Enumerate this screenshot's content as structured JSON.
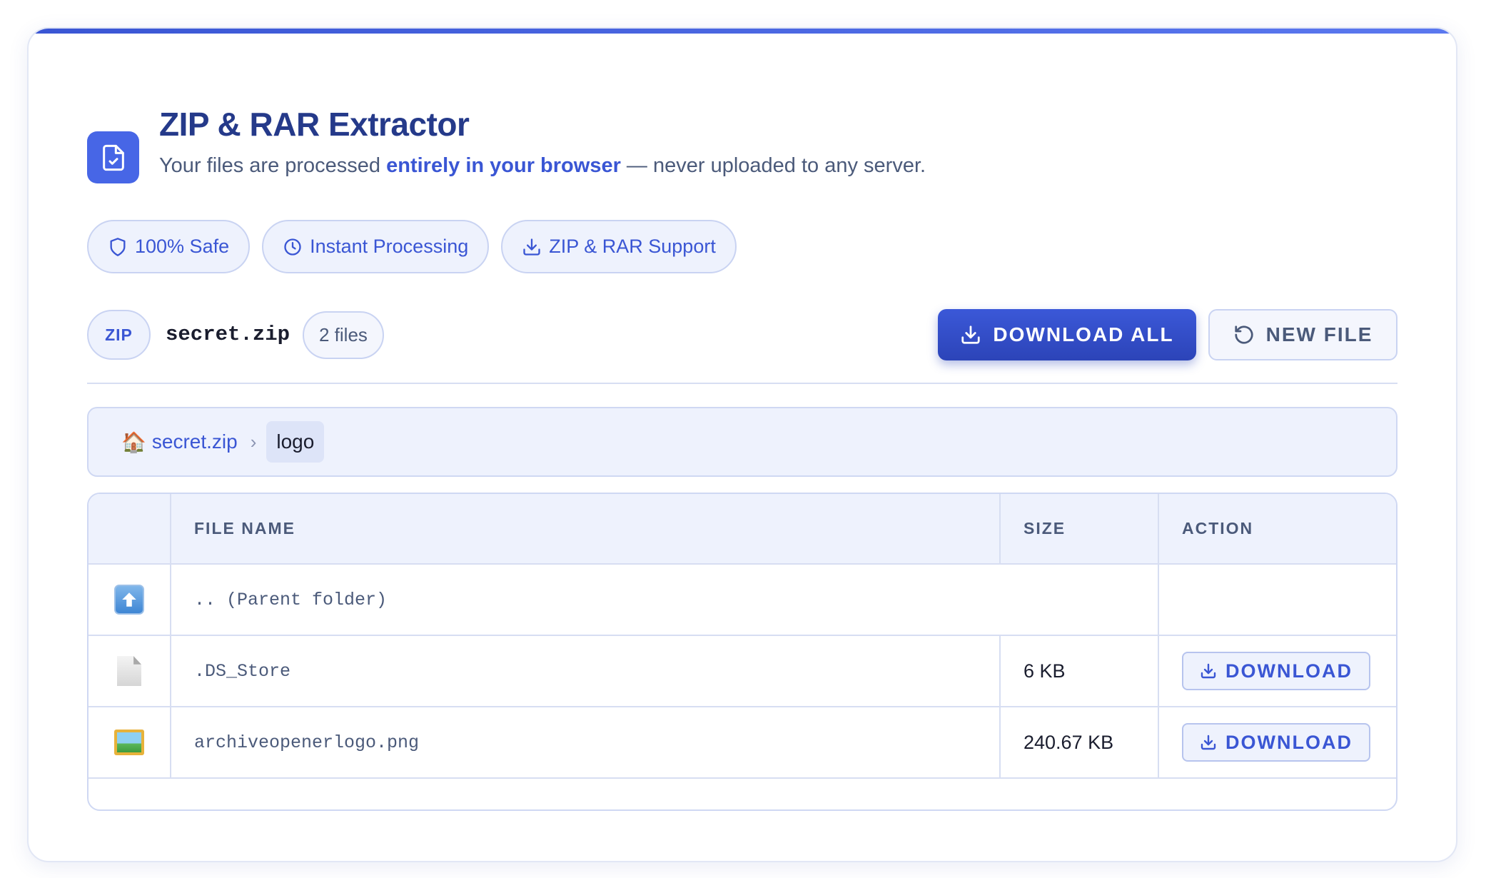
{
  "app": {
    "title": "ZIP & RAR Extractor",
    "subtitle_pre": "Your files are processed ",
    "subtitle_em": "entirely in your browser",
    "subtitle_post": " — never uploaded to any server.",
    "logo_icon": "file-check-icon"
  },
  "badges": [
    {
      "label": "100% Safe",
      "icon": "shield-icon"
    },
    {
      "label": "Instant Processing",
      "icon": "clock-icon"
    },
    {
      "label": "ZIP & RAR Support",
      "icon": "download-icon"
    }
  ],
  "archive": {
    "type": "ZIP",
    "name": "secret.zip",
    "count": "2 files"
  },
  "actions": {
    "download_all": "DOWNLOAD ALL",
    "new_file": "NEW FILE"
  },
  "breadcrumb": {
    "home_icon": "🏠",
    "root": "secret.zip",
    "separator": "›",
    "current": "logo"
  },
  "table": {
    "headers": {
      "name": "FILE NAME",
      "size": "SIZE",
      "action": "ACTION"
    },
    "parent_row": {
      "label": ".. (Parent folder)",
      "icon": "arrow-up-icon"
    },
    "rows": [
      {
        "name": ".DS_Store",
        "size": "6 KB",
        "action": "DOWNLOAD",
        "icon": "document-icon"
      },
      {
        "name": "archiveopenerlogo.png",
        "size": "240.67 KB",
        "action": "DOWNLOAD",
        "icon": "image-icon"
      }
    ]
  },
  "colors": {
    "accent": "#3a56d4",
    "title": "#253a8a",
    "panel": "#eef2fd",
    "border": "#cfd8f3"
  }
}
